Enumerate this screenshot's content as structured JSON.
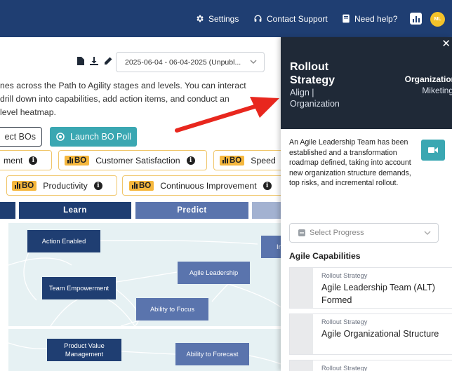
{
  "topnav": {
    "settings_label": "Settings",
    "support_label": "Contact Support",
    "help_label": "Need help?",
    "avatar_initials": "ML",
    "bg_color": "#1f3e72",
    "accent_color": "#f3c229"
  },
  "toolbar": {
    "date_range": "2025-06-04 - 06-04-2025 (Unpubl...",
    "icons": [
      "document-icon",
      "download-icon",
      "pencil-icon"
    ]
  },
  "intro_lines": [
    "nes across the Path to Agility stages and levels. You can interact",
    "drill down into capabilities, add action items, and conduct an",
    "level heatmap."
  ],
  "buttons": {
    "select_bos": "ect BOs",
    "launch_poll": "Launch BO Poll"
  },
  "bo_badge": "BO",
  "bo_chips": {
    "employee_engagement": "ment",
    "customer_satisfaction": "Customer Satisfaction",
    "speed": "Speed",
    "productivity": "Productivity",
    "continuous_improvement": "Continuous Improvement"
  },
  "stages": {
    "learn": "Learn",
    "predict": "Predict"
  },
  "map_nodes": {
    "action_enabled": "Action Enabled",
    "team_empowerment": "Team Empowerment",
    "agile_leadership": "Agile Leadership",
    "ability_to_focus": "Ability to Focus",
    "product_value_management": "Product Value Management",
    "ability_to_forecast": "Ability to Forecast",
    "partial": "In"
  },
  "panel": {
    "title": "Rollout Strategy",
    "subtitle": "Align | Organization",
    "org_label": "Organization",
    "org_value": "Miketing",
    "description": "An Agile Leadership Team has been established and a transformation roadmap defined, taking into account new organization structure demands, top risks, and incremental rollout.",
    "progress_placeholder": "Select Progress",
    "capabilities_heading": "Agile Capabilities",
    "capabilities": [
      {
        "category": "Rollout Strategy",
        "name": "Agile Leadership Team (ALT) Formed"
      },
      {
        "category": "Rollout Strategy",
        "name": "Agile Organizational Structure"
      },
      {
        "category": "Rollout Strategy",
        "name": ""
      }
    ],
    "header_color": "#1f2937",
    "video_button_color": "#3aa7b2"
  }
}
